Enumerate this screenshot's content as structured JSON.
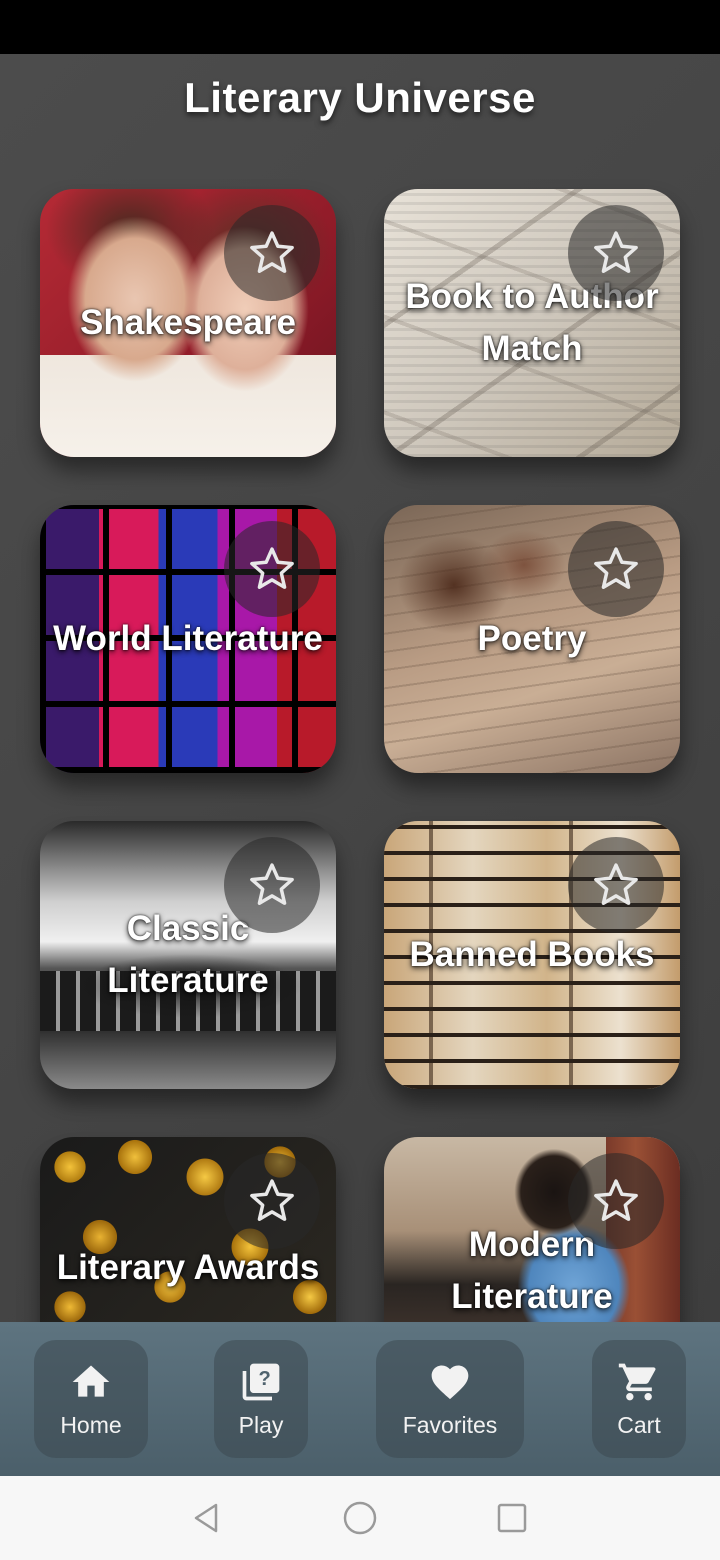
{
  "app": {
    "title": "Literary Universe"
  },
  "categories": [
    {
      "label": "Shakespeare"
    },
    {
      "label": "Book to Author Match"
    },
    {
      "label": "World Literature"
    },
    {
      "label": "Poetry"
    },
    {
      "label": "Classic Literature"
    },
    {
      "label": "Banned Books"
    },
    {
      "label": "Literary Awards"
    },
    {
      "label": "Modern Literature"
    }
  ],
  "favorite_icon": "star-outline-icon",
  "bottom_nav": [
    {
      "label": "Home",
      "icon": "home-icon"
    },
    {
      "label": "Play",
      "icon": "quiz-icon"
    },
    {
      "label": "Favorites",
      "icon": "heart-icon"
    },
    {
      "label": "Cart",
      "icon": "cart-icon"
    }
  ],
  "system_nav": [
    "back-icon",
    "home-circle-icon",
    "recents-icon"
  ],
  "colors": {
    "background": "#4a4a4a",
    "bottom_nav": "#5a6f7b",
    "text": "#ffffff"
  }
}
